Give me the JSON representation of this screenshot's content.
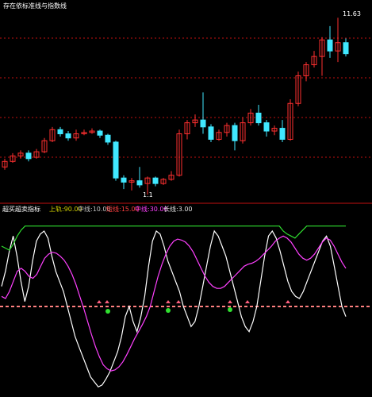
{
  "top_panel": {
    "title": "存在依标准线与指数线",
    "price_label": "11.63",
    "low_label": "1.1"
  },
  "indicator_panel": {
    "name": "超买超卖指标",
    "values": [
      {
        "label": "上轨",
        "value": "90.00",
        "color": "#d0d000"
      },
      {
        "label": "中线",
        "value": "10.00",
        "color": "#c0c0c0"
      },
      {
        "label": "短线",
        "value": "15.00",
        "color": "#ff4040"
      },
      {
        "label": "中线",
        "value": "30.00",
        "color": "#ff40ff"
      },
      {
        "label": "长线",
        "value": "3.00",
        "color": "#e0e0e0"
      }
    ]
  },
  "colors": {
    "up_candle": "#ff3030",
    "down_candle": "#40e8ff",
    "grid": "#c01010",
    "white_line": "#ffffff",
    "magenta_line": "#ff40ff",
    "green_line": "#30e030",
    "pink_baseline": "#ff8080"
  },
  "chart_data": [
    {
      "type": "candlestick",
      "series": [
        {
          "name": "candles",
          "values": [
            [
              5.6,
              6.0,
              5.4,
              6.2
            ],
            [
              6.0,
              6.4,
              5.9,
              6.6
            ],
            [
              6.4,
              6.6,
              6.2,
              6.8
            ],
            [
              6.6,
              6.2,
              6.0,
              6.8
            ],
            [
              6.3,
              6.7,
              6.2,
              6.9
            ],
            [
              6.7,
              7.5,
              6.6,
              7.7
            ],
            [
              7.5,
              8.3,
              7.4,
              8.5
            ],
            [
              8.3,
              8.0,
              7.8,
              8.5
            ],
            [
              8.0,
              7.7,
              7.5,
              8.2
            ],
            [
              7.7,
              8.0,
              7.5,
              8.3
            ],
            [
              8.0,
              8.1,
              7.9,
              8.3
            ],
            [
              8.1,
              8.2,
              8.0,
              8.4
            ],
            [
              8.2,
              7.9,
              7.7,
              8.3
            ],
            [
              7.9,
              7.4,
              7.2,
              8.0
            ],
            [
              7.4,
              4.8,
              4.6,
              7.5
            ],
            [
              4.8,
              4.5,
              4.0,
              5.0
            ],
            [
              4.5,
              4.6,
              3.9,
              4.8
            ],
            [
              4.6,
              4.3,
              4.1,
              5.6
            ],
            [
              4.4,
              4.8,
              3.6,
              4.9
            ],
            [
              4.8,
              4.4,
              4.2,
              4.9
            ],
            [
              4.4,
              4.7,
              4.3,
              4.8
            ],
            [
              4.7,
              5.0,
              4.6,
              5.3
            ],
            [
              5.0,
              8.0,
              4.9,
              8.3
            ],
            [
              8.0,
              8.8,
              7.6,
              9.0
            ],
            [
              8.8,
              9.0,
              8.5,
              9.4
            ],
            [
              9.0,
              8.5,
              8.0,
              11.0
            ],
            [
              8.5,
              7.6,
              7.4,
              8.7
            ],
            [
              7.6,
              8.1,
              7.5,
              8.3
            ],
            [
              8.1,
              8.6,
              7.8,
              8.8
            ],
            [
              8.6,
              7.5,
              6.8,
              8.8
            ],
            [
              7.5,
              8.8,
              7.3,
              9.2
            ],
            [
              8.8,
              9.5,
              8.6,
              9.8
            ],
            [
              9.5,
              8.8,
              8.6,
              10.1
            ],
            [
              8.8,
              8.2,
              7.8,
              9.0
            ],
            [
              8.2,
              8.4,
              7.9,
              8.6
            ],
            [
              8.4,
              7.6,
              7.4,
              9.0
            ],
            [
              7.6,
              10.2,
              7.5,
              10.5
            ],
            [
              10.2,
              12.2,
              10.0,
              12.5
            ],
            [
              12.2,
              13.0,
              11.8,
              13.2
            ],
            [
              13.0,
              13.6,
              12.8,
              14.0
            ],
            [
              13.6,
              14.8,
              12.2,
              15.0
            ],
            [
              14.8,
              14.0,
              13.5,
              15.8
            ],
            [
              14.0,
              14.6,
              13.2,
              16.4
            ],
            [
              14.6,
              13.8,
              13.6,
              14.9
            ]
          ]
        }
      ]
    },
    {
      "type": "line",
      "series": [
        {
          "name": "white",
          "color": "#ffffff",
          "values": [
            40,
            55,
            75,
            90,
            70,
            45,
            25,
            40,
            65,
            85,
            92,
            95,
            88,
            70,
            55,
            45,
            35,
            20,
            5,
            -10,
            -20,
            -30,
            -40,
            -50,
            -55,
            -60,
            -58,
            -52,
            -45,
            -35,
            -25,
            -10,
            10,
            20,
            5,
            -5,
            10,
            30,
            60,
            85,
            95,
            92,
            80,
            65,
            55,
            45,
            35,
            20,
            10,
            0,
            5,
            20,
            40,
            60,
            80,
            95,
            90,
            80,
            70,
            55,
            40,
            25,
            10,
            0,
            -5,
            5,
            20,
            45,
            70,
            90,
            95,
            88,
            75,
            60,
            45,
            35,
            30,
            28,
            35,
            45,
            55,
            65,
            75,
            85,
            90,
            80,
            60,
            40,
            20,
            10
          ]
        },
        {
          "name": "magenta",
          "color": "#ff40ff",
          "values": [
            30,
            28,
            35,
            45,
            55,
            58,
            55,
            50,
            48,
            52,
            60,
            68,
            72,
            74,
            73,
            70,
            66,
            60,
            52,
            42,
            30,
            18,
            5,
            -8,
            -20,
            -30,
            -38,
            -42,
            -44,
            -43,
            -40,
            -35,
            -28,
            -20,
            -12,
            -5,
            2,
            10,
            20,
            35,
            50,
            62,
            72,
            80,
            85,
            87,
            86,
            84,
            80,
            74,
            66,
            58,
            50,
            44,
            40,
            38,
            38,
            40,
            44,
            48,
            52,
            56,
            60,
            62,
            63,
            65,
            68,
            72,
            76,
            80,
            85,
            88,
            90,
            88,
            84,
            78,
            72,
            68,
            66,
            68,
            72,
            78,
            84,
            88,
            86,
            80,
            72,
            64,
            58
          ]
        },
        {
          "name": "green",
          "color": "#30e030",
          "values": [
            80,
            78,
            76,
            82,
            90,
            96,
            100,
            100,
            100,
            100,
            100,
            100,
            100,
            100,
            100,
            100,
            100,
            100,
            100,
            100,
            100,
            100,
            100,
            100,
            100,
            100,
            100,
            100,
            100,
            100,
            100,
            100,
            100,
            100,
            100,
            100,
            100,
            100,
            100,
            100,
            100,
            100,
            100,
            100,
            100,
            100,
            100,
            100,
            100,
            100,
            100,
            100,
            100,
            100,
            100,
            100,
            100,
            100,
            100,
            100,
            100,
            100,
            100,
            100,
            100,
            100,
            100,
            100,
            100,
            100,
            100,
            100,
            95,
            92,
            90,
            88,
            92,
            96,
            100,
            100,
            100,
            100,
            100,
            100,
            100,
            100,
            100,
            100,
            100
          ]
        }
      ],
      "baseline": 20
    }
  ]
}
